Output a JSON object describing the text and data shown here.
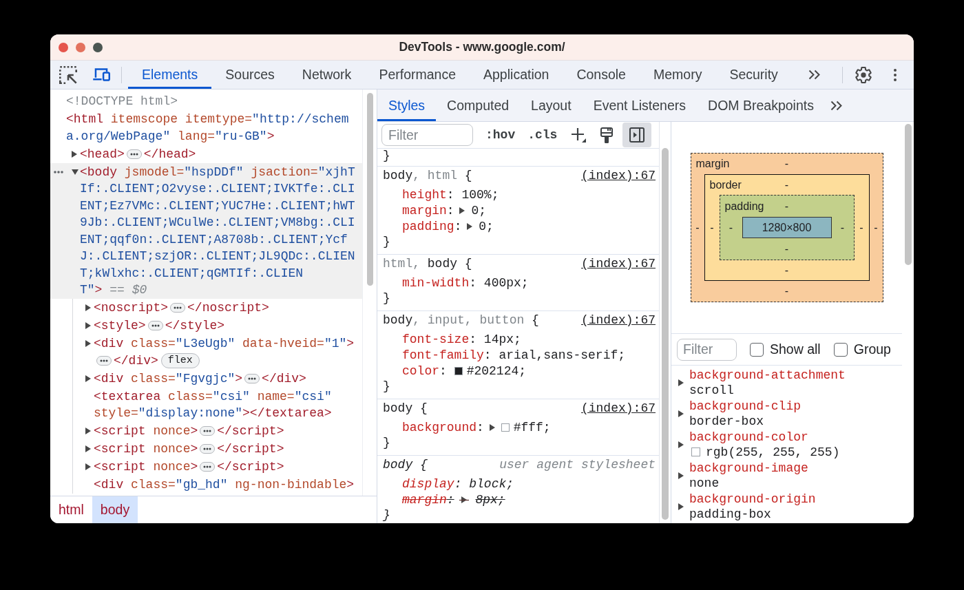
{
  "window": {
    "title": "DevTools - www.google.com/"
  },
  "toolbar": {
    "device_mode": {
      "on": true
    },
    "tabs": [
      {
        "label": "Elements",
        "selected": true
      },
      {
        "label": "Sources",
        "selected": false
      },
      {
        "label": "Network",
        "selected": false
      },
      {
        "label": "Performance",
        "selected": false
      },
      {
        "label": "Application",
        "selected": false
      },
      {
        "label": "Console",
        "selected": false
      },
      {
        "label": "Memory",
        "selected": false
      },
      {
        "label": "Security",
        "selected": false
      }
    ]
  },
  "elements": {
    "tree": [
      {
        "selected": false,
        "lines": [
          [
            {
              "kind": "doctype",
              "text": "<!DOCTYPE html>"
            }
          ]
        ]
      },
      {
        "selected": false,
        "lines": [
          [
            {
              "kind": "tag",
              "text": "<html"
            },
            {
              "kind": "attr",
              "text": " itemscope"
            },
            {
              "kind": "attr",
              "text": " itemtype="
            },
            {
              "kind": "value",
              "text": "\"http://schem"
            }
          ],
          [
            {
              "kind": "value",
              "text": "a.org/WebPage\""
            },
            {
              "kind": "attr",
              "text": " lang="
            },
            {
              "kind": "value",
              "text": "\"ru-GB\""
            },
            {
              "kind": "tag",
              "text": ">"
            }
          ]
        ],
        "children": [
          {
            "selected": false,
            "expanded": false,
            "lines": [
              [
                {
                  "kind": "tag",
                  "text": "<head>"
                },
                {
                  "kind": "ellipsis"
                },
                {
                  "kind": "tag",
                  "text": "</head>"
                }
              ]
            ]
          },
          {
            "selected": true,
            "expanded": true,
            "lines": [
              [
                {
                  "kind": "tag",
                  "text": "<body"
                },
                {
                  "kind": "attr",
                  "text": " jsmodel="
                },
                {
                  "kind": "value",
                  "text": "\"hspDDf\""
                },
                {
                  "kind": "attr",
                  "text": " jsaction="
                },
                {
                  "kind": "value",
                  "text": "\"xjhT"
                }
              ],
              [
                {
                  "kind": "value",
                  "text": "If:.CLIENT;O2vyse:.CLIENT;IVKTfe:.CLI"
                }
              ],
              [
                {
                  "kind": "value",
                  "text": "ENT;Ez7VMc:.CLIENT;YUC7He:.CLIENT;hWT"
                }
              ],
              [
                {
                  "kind": "value",
                  "text": "9Jb:.CLIENT;WCulWe:.CLIENT;VM8bg:.CLI"
                }
              ],
              [
                {
                  "kind": "value",
                  "text": "ENT;qqf0n:.CLIENT;A8708b:.CLIENT;Ycf"
                }
              ],
              [
                {
                  "kind": "value",
                  "text": "J:.CLIENT;szjOR:.CLIENT;JL9QDc:.CLIEN"
                }
              ],
              [
                {
                  "kind": "value",
                  "text": "T;kWlxhc:.CLIENT;qGMTIf:.CLIEN"
                }
              ],
              [
                {
                  "kind": "value",
                  "text": "T\""
                },
                {
                  "kind": "tag",
                  "text": ">"
                },
                {
                  "kind": "marker",
                  "text": " == $0"
                }
              ]
            ],
            "children": [
              {
                "selected": false,
                "expanded": false,
                "lines": [
                  [
                    {
                      "kind": "tag",
                      "text": "<noscript>"
                    },
                    {
                      "kind": "ellipsis"
                    },
                    {
                      "kind": "tag",
                      "text": "</noscript>"
                    }
                  ]
                ]
              },
              {
                "selected": false,
                "expanded": false,
                "lines": [
                  [
                    {
                      "kind": "tag",
                      "text": "<style>"
                    },
                    {
                      "kind": "ellipsis"
                    },
                    {
                      "kind": "tag",
                      "text": "</style>"
                    }
                  ]
                ]
              },
              {
                "selected": false,
                "expanded": false,
                "lines": [
                  [
                    {
                      "kind": "tag",
                      "text": "<div"
                    },
                    {
                      "kind": "attr",
                      "text": " class="
                    },
                    {
                      "kind": "value",
                      "text": "\"L3eUgb\""
                    },
                    {
                      "kind": "attr",
                      "text": " data-hveid="
                    },
                    {
                      "kind": "value",
                      "text": "\"1\""
                    },
                    {
                      "kind": "tag",
                      "text": ">"
                    }
                  ],
                  [
                    {
                      "kind": "ellipsis"
                    },
                    {
                      "kind": "tag",
                      "text": "</div>"
                    },
                    {
                      "kind": "badge",
                      "text": "flex"
                    }
                  ]
                ]
              },
              {
                "selected": false,
                "expanded": false,
                "lines": [
                  [
                    {
                      "kind": "tag",
                      "text": "<div"
                    },
                    {
                      "kind": "attr",
                      "text": " class="
                    },
                    {
                      "kind": "value",
                      "text": "\"Fgvgjc\""
                    },
                    {
                      "kind": "tag",
                      "text": ">"
                    },
                    {
                      "kind": "ellipsis"
                    },
                    {
                      "kind": "tag",
                      "text": "</div>"
                    }
                  ]
                ]
              },
              {
                "selected": false,
                "lines": [
                  [
                    {
                      "kind": "tag",
                      "text": "<textarea"
                    },
                    {
                      "kind": "attr",
                      "text": " class="
                    },
                    {
                      "kind": "value",
                      "text": "\"csi\""
                    },
                    {
                      "kind": "attr",
                      "text": " name="
                    },
                    {
                      "kind": "value",
                      "text": "\"csi\""
                    }
                  ],
                  [
                    {
                      "kind": "attr",
                      "text": "style="
                    },
                    {
                      "kind": "value",
                      "text": "\"display:none\""
                    },
                    {
                      "kind": "tag",
                      "text": "></textarea>"
                    }
                  ]
                ]
              },
              {
                "selected": false,
                "expanded": false,
                "lines": [
                  [
                    {
                      "kind": "tag",
                      "text": "<script"
                    },
                    {
                      "kind": "attr",
                      "text": " nonce"
                    },
                    {
                      "kind": "tag",
                      "text": ">"
                    },
                    {
                      "kind": "ellipsis"
                    },
                    {
                      "kind": "tag",
                      "text": "</script>"
                    }
                  ]
                ]
              },
              {
                "selected": false,
                "expanded": false,
                "lines": [
                  [
                    {
                      "kind": "tag",
                      "text": "<script"
                    },
                    {
                      "kind": "attr",
                      "text": " nonce"
                    },
                    {
                      "kind": "tag",
                      "text": ">"
                    },
                    {
                      "kind": "ellipsis"
                    },
                    {
                      "kind": "tag",
                      "text": "</script>"
                    }
                  ]
                ]
              },
              {
                "selected": false,
                "expanded": false,
                "lines": [
                  [
                    {
                      "kind": "tag",
                      "text": "<script"
                    },
                    {
                      "kind": "attr",
                      "text": " nonce"
                    },
                    {
                      "kind": "tag",
                      "text": ">"
                    },
                    {
                      "kind": "ellipsis"
                    },
                    {
                      "kind": "tag",
                      "text": "</script>"
                    }
                  ]
                ]
              },
              {
                "selected": false,
                "lines": [
                  [
                    {
                      "kind": "tag",
                      "text": "<div"
                    },
                    {
                      "kind": "attr",
                      "text": " class="
                    },
                    {
                      "kind": "value",
                      "text": "\"gb_hd\""
                    },
                    {
                      "kind": "attr",
                      "text": " ng-non-bindable"
                    },
                    {
                      "kind": "tag",
                      "text": ">"
                    }
                  ]
                ]
              }
            ]
          }
        ]
      }
    ],
    "breadcrumbs": [
      {
        "label": "html",
        "selected": false
      },
      {
        "label": "body",
        "selected": true
      }
    ]
  },
  "sidebar": {
    "tabs": [
      {
        "label": "Styles",
        "selected": true
      },
      {
        "label": "Computed",
        "selected": false
      },
      {
        "label": "Layout",
        "selected": false
      },
      {
        "label": "Event Listeners",
        "selected": false
      },
      {
        "label": "DOM Breakpoints",
        "selected": false
      }
    ],
    "styles": {
      "filter": {
        "placeholder": "Filter"
      },
      "buttons": [
        ":hov",
        ".cls"
      ],
      "sidebar_toggle": {
        "on": true
      },
      "scrolled_rule_end": "}",
      "rules": [
        {
          "kind": "author",
          "selector": [
            {
              "text": "body",
              "matched": true
            },
            {
              "text": ", html",
              "matched": false
            },
            {
              "text": " {",
              "matched": true
            }
          ],
          "source": "(index):67",
          "properties": [
            {
              "name": "height",
              "colon": ":",
              "value": "100%;",
              "overridden": false
            },
            {
              "name": "margin",
              "colon": ":",
              "expanded": false,
              "value": "0;",
              "overridden": false
            },
            {
              "name": "padding",
              "colon": ":",
              "expanded": false,
              "value": "0;",
              "overridden": false
            }
          ],
          "close": "}"
        },
        {
          "kind": "author",
          "selector": [
            {
              "text": "html,",
              "matched": false
            },
            {
              "text": " body {",
              "matched": true
            }
          ],
          "source": "(index):67",
          "properties": [
            {
              "name": "min-width",
              "colon": ":",
              "value": "400px;",
              "overridden": false
            }
          ],
          "close": "}"
        },
        {
          "kind": "author",
          "selector": [
            {
              "text": "body",
              "matched": true
            },
            {
              "text": ", input, button",
              "matched": false
            },
            {
              "text": " {",
              "matched": true
            }
          ],
          "source": "(index):67",
          "properties": [
            {
              "name": "font-size",
              "colon": ":",
              "value": "14px;",
              "overridden": false
            },
            {
              "name": "font-family",
              "colon": ":",
              "value": "arial,sans-serif;",
              "overridden": false
            },
            {
              "name": "color",
              "colon": ":",
              "color": "#202124",
              "value": "#202124;",
              "overridden": false
            }
          ],
          "close": "}"
        },
        {
          "kind": "author",
          "selector": [
            {
              "text": "body {",
              "matched": true
            }
          ],
          "source": "(index):67",
          "properties": [
            {
              "name": "background",
              "colon": ":",
              "expanded": false,
              "color": "#ffffff",
              "value": "#fff;",
              "overridden": false
            }
          ],
          "close": "}"
        },
        {
          "kind": "user_agent",
          "selector": [
            {
              "text": "body {",
              "matched": true
            }
          ],
          "source": "user agent stylesheet",
          "properties": [
            {
              "name": "display",
              "colon": ":",
              "value": "block;",
              "overridden": false
            },
            {
              "name": "margin",
              "colon": ":",
              "expanded": false,
              "value": "8px;",
              "overridden": true
            }
          ],
          "close": "}"
        }
      ]
    },
    "computed": {
      "box_model": {
        "margin": {
          "label": "margin",
          "top": "-",
          "right": "-",
          "bottom": "-",
          "left": "-"
        },
        "border": {
          "label": "border",
          "top": "-",
          "right": "-",
          "bottom": "-",
          "left": "-"
        },
        "padding": {
          "label": "padding",
          "top": "-",
          "right": "-",
          "bottom": "-",
          "left": "-"
        },
        "content": "1280×800"
      },
      "filter": {
        "placeholder": "Filter"
      },
      "options": [
        {
          "label": "Show all",
          "checked": false
        },
        {
          "label": "Group",
          "checked": false
        }
      ],
      "properties": [
        {
          "name": "background-attachment",
          "value": "scroll",
          "expanded": false
        },
        {
          "name": "background-clip",
          "value": "border-box",
          "expanded": false
        },
        {
          "name": "background-color",
          "color": "#ffffff",
          "value": "rgb(255, 255, 255)",
          "expanded": false
        },
        {
          "name": "background-image",
          "value": "none",
          "expanded": false
        },
        {
          "name": "background-origin",
          "value": "padding-box",
          "expanded": false
        }
      ]
    }
  }
}
